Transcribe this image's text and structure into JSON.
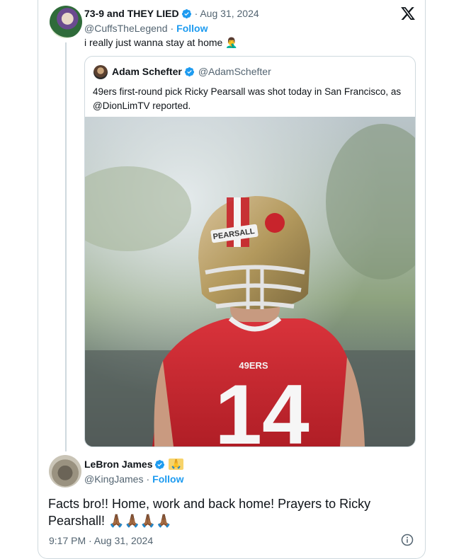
{
  "tweet": {
    "author_name": "73-9 and THEY LIED",
    "date": "· Aug 31, 2024",
    "handle": "@CuffsTheLegend",
    "separator": "·",
    "follow_label": "Follow",
    "text": "i really just wanna stay at home 🤦‍♂️"
  },
  "quote": {
    "author_name": "Adam Schefter",
    "handle": "@AdamSchefter",
    "text": "49ers first-round pick Ricky Pearsall was shot today in San Francisco, as @DionLimTV reported.",
    "photo": {
      "helmet_label": "PEARSALL",
      "jersey_number": "14",
      "jersey_wordmark": "49ERS"
    }
  },
  "reply": {
    "author_name": "LeBron James",
    "emoji": "🙏",
    "handle": "@KingJames",
    "separator": "·",
    "follow_label": "Follow",
    "text": "Facts bro!! Home, work and back home! Prayers to Ricky Pearshall! 🙏🏾🙏🏾🙏🏾🙏🏾",
    "timestamp": "9:17 PM · Aug 31, 2024"
  },
  "colors": {
    "accent": "#1d9bf0",
    "muted": "#536471",
    "border": "#cfd9de",
    "jersey_red": "#c8242c",
    "helmet_gold": "#b3995d"
  },
  "icons": [
    "verified-badge-icon",
    "x-logo-icon",
    "info-icon"
  ]
}
